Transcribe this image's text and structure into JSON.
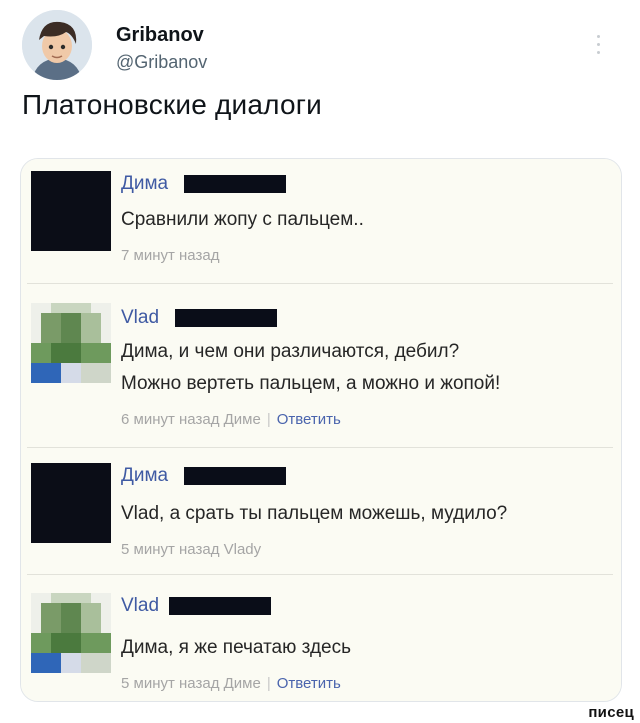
{
  "tweet": {
    "author_name": "Gribanov",
    "author_handle": "@Gribanov",
    "text": "Платоновские диалоги"
  },
  "comments": [
    {
      "name": "Дима",
      "avatar": "dark-square",
      "lines": [
        "Сравнили жопу с пальцем.."
      ],
      "meta_time": "7 минут назад",
      "meta_to": "",
      "reply_label": ""
    },
    {
      "name": "Vlad",
      "avatar": "green-pixelated",
      "lines": [
        "Дима, и чем они различаются, дебил?",
        "Можно вертеть пальцем, а можно и жопой!"
      ],
      "meta_time": "6 минут назад Диме",
      "meta_to": "|",
      "reply_label": "Ответить"
    },
    {
      "name": "Дима",
      "avatar": "dark-square",
      "lines": [
        "Vlad, а срать ты пальцем можешь, мудило?"
      ],
      "meta_time": "5 минут назад Vlady",
      "meta_to": "",
      "reply_label": ""
    },
    {
      "name": "Vlad",
      "avatar": "green-pixelated",
      "lines": [
        "Дима, я же печатаю здесь"
      ],
      "meta_time": "5 минут назад Диме",
      "meta_to": "|",
      "reply_label": "Ответить"
    }
  ],
  "watermark": "писец",
  "colors": {
    "name_link": "#3f5aa3",
    "card_bg": "#fbfbf3",
    "redaction": "#0a0d18"
  }
}
